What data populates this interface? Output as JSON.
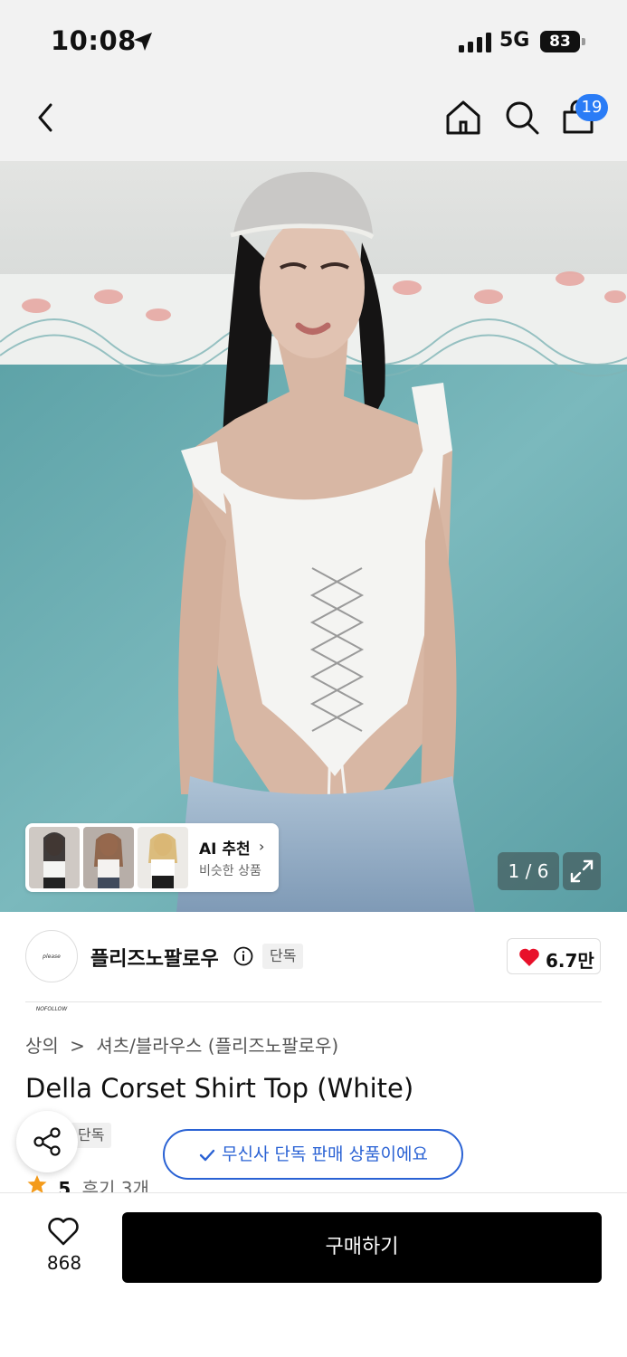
{
  "status_bar": {
    "time": "10:08",
    "network": "5G",
    "battery": "83"
  },
  "nav": {
    "cart_count": "19"
  },
  "gallery": {
    "page_counter": "1 / 6",
    "ai_recommend": {
      "title": "AI 추천",
      "subtitle": "비슷한 상품"
    }
  },
  "brand": {
    "logo_text": "please NOFOLLOW",
    "name": "플리즈노팔로우",
    "exclusive_tag": "단독",
    "like_count": "6.7만"
  },
  "product": {
    "breadcrumb": [
      "상의",
      ">",
      "셔츠/블라우스 (플리즈노팔로우)"
    ],
    "title": "Della Corset Shirt Top (White)",
    "exclusive_tag": "단독",
    "exclusive_notice": "무신사 단독 판매 상품이에요",
    "rating": "5",
    "review_text": "후기 3개"
  },
  "bottom_bar": {
    "wish_count": "868",
    "buy_label": "구매하기"
  },
  "colors": {
    "accent_blue": "#2a62d4",
    "badge_blue": "#2a7cf6",
    "heart_red": "#e8102a",
    "star_orange": "#f49b1b"
  }
}
